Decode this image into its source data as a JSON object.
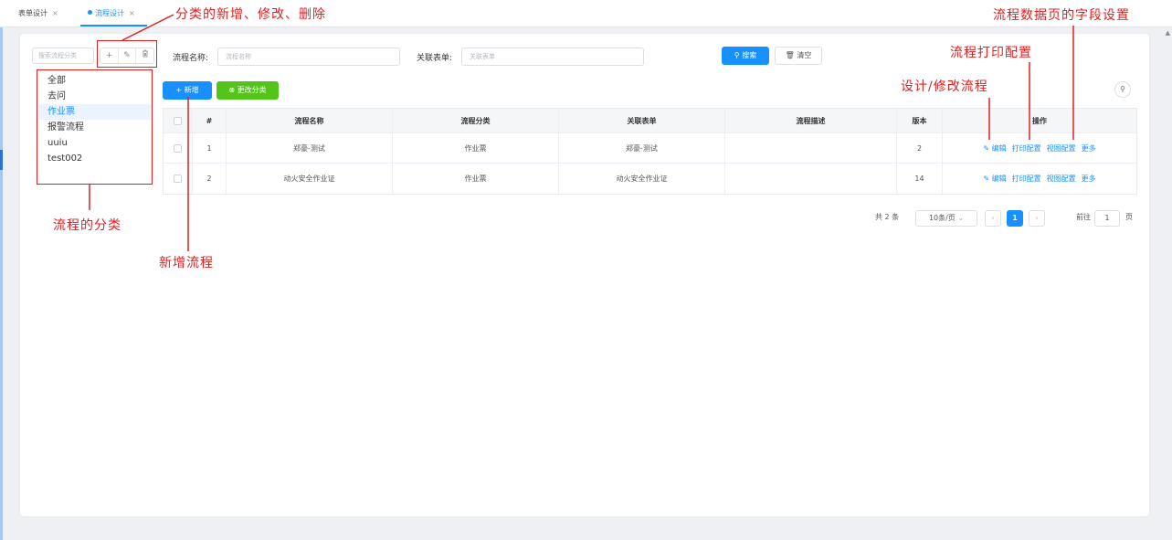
{
  "tabs": [
    {
      "label": "表单设计",
      "close": "×",
      "active": false
    },
    {
      "label": "流程设计",
      "close": "×",
      "active": true
    }
  ],
  "category": {
    "search_placeholder": "搜索流程分类",
    "add_icon": "+",
    "edit_icon": "✎",
    "delete_icon": "🗑",
    "items": [
      "全部",
      "去问",
      "作业票",
      "报警流程",
      "uuiu",
      "test002"
    ],
    "selected_index": 2
  },
  "filters": {
    "name_label": "流程名称:",
    "name_placeholder": "流程名称",
    "form_label": "关联表单:",
    "form_placeholder": "关联表单",
    "search_button": "搜索",
    "clear_button": "清空"
  },
  "toolbar": {
    "add_button": "新增",
    "change_category_button": "更改分类"
  },
  "table": {
    "headers": [
      "#",
      "流程名称",
      "流程分类",
      "关联表单",
      "流程描述",
      "版本",
      "操作"
    ],
    "rows": [
      {
        "index": "1",
        "name": "郑豪-测试",
        "category": "作业票",
        "form": "郑豪-测试",
        "desc": "",
        "version": "2"
      },
      {
        "index": "2",
        "name": "动火安全作业证",
        "category": "作业票",
        "form": "动火安全作业证",
        "desc": "",
        "version": "14"
      }
    ],
    "actions": {
      "edit": "编辑",
      "print": "打印配置",
      "view": "视图配置",
      "more": "更多"
    }
  },
  "pagination": {
    "total": "共 2 条",
    "page_size": "10条/页",
    "current_page": "1",
    "goto_label": "前往",
    "goto_value": "1",
    "page_suffix": "页"
  },
  "annotations": {
    "category_ops": "分类的新增、修改、删除",
    "category_list": "流程的分类",
    "add_process": "新增流程",
    "design_process": "设计/修改流程",
    "print_config": "流程打印配置",
    "field_settings": "流程数据页的字段设置"
  },
  "colors": {
    "primary": "#1890ff",
    "success": "#52c41a",
    "annotation": "#e02020"
  }
}
